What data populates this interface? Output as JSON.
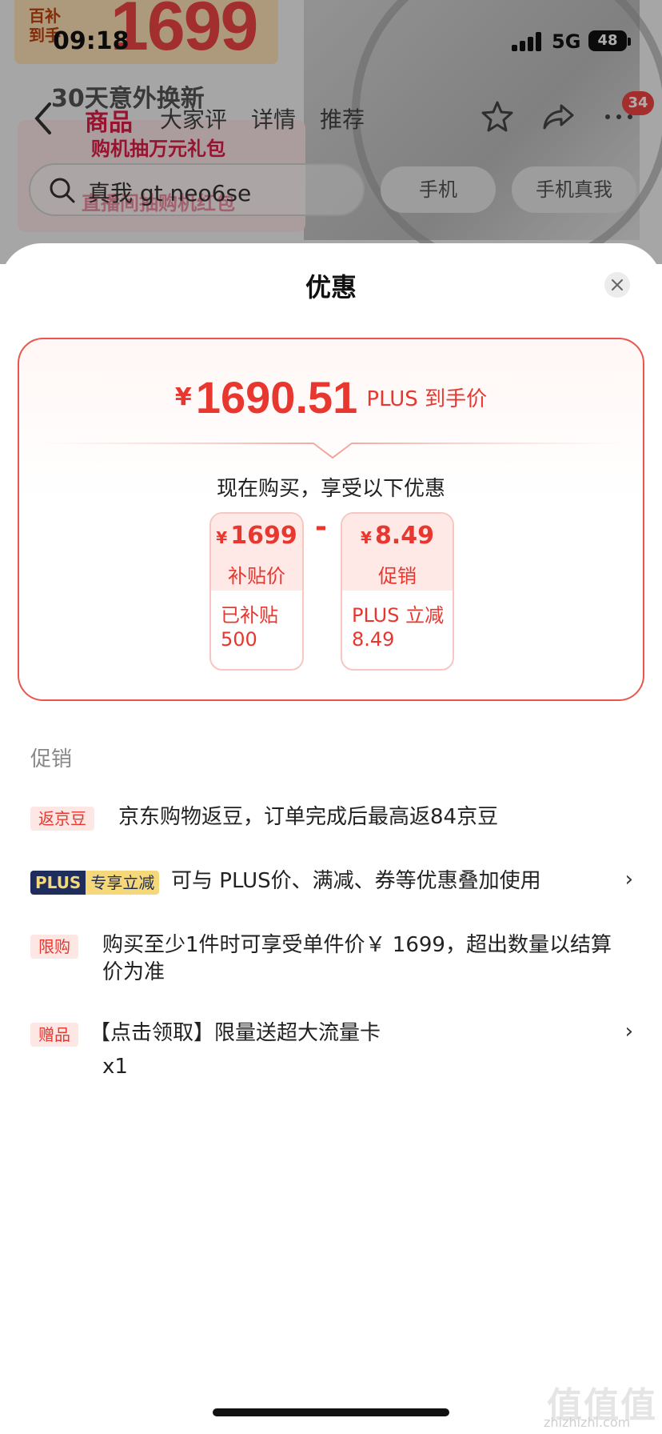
{
  "status_bar": {
    "time": "09:18",
    "network": "5G",
    "battery": "48"
  },
  "background_page": {
    "promo_small": "百补\n到手",
    "promo_price": "1699",
    "promo_line": "30天意外换新",
    "gift_line_1": "购机抽万元礼包",
    "gift_line_2": "直播间抽购机红包",
    "tabs": [
      "商品",
      "大家评",
      "详情",
      "推荐"
    ],
    "active_tab": "商品",
    "message_badge": "34",
    "search_query": "真我 gt neo6se",
    "chips": [
      "手机",
      "手机真我"
    ]
  },
  "sheet": {
    "title": "优惠",
    "final_price": {
      "currency": "¥",
      "amount": "1690.51",
      "label": "PLUS 到手价"
    },
    "buy_text": "现在购买，享受以下优惠",
    "breakdown": [
      {
        "currency": "¥",
        "value": "1699",
        "label": "补贴价",
        "note_line1": "已补贴",
        "note_line2": "500"
      },
      {
        "currency": "¥",
        "value": "8.49",
        "label": "促销",
        "note_line1": "PLUS 立减",
        "note_line2": "8.49"
      }
    ],
    "operator": "-",
    "section_label": "促销",
    "promotions": [
      {
        "tag": "返京豆",
        "text": "京东购物返豆，订单完成后最高返84京豆"
      },
      {
        "tag_a": "PLUS",
        "tag_b": "专享立减",
        "text": "可与 PLUS价、满减、券等优惠叠加使用",
        "chevron": "›"
      },
      {
        "tag": "限购",
        "text": "购买至少1件时可享受单件价￥ 1699，超出数量以结算价为准"
      },
      {
        "tag": "赠品",
        "text": "【点击领取】限量送超大流量卡",
        "subtext": "x1",
        "chevron": "›"
      }
    ]
  },
  "watermark": {
    "big": "值值值",
    "small": "zhizhizhi.com"
  },
  "colors": {
    "accent": "#e8372f",
    "plus_navy": "#1f2d5c",
    "plus_gold": "#f5d87a"
  }
}
